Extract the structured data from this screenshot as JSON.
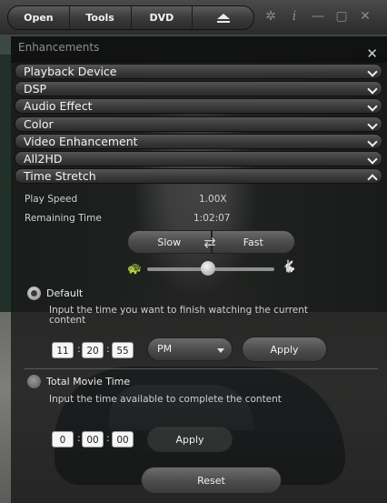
{
  "menu": {
    "open_label": "Open",
    "tools_label": "Tools",
    "dvd_label": "DVD"
  },
  "window_icons": [
    "settings-icon",
    "info-icon",
    "minimize-icon",
    "restore-icon",
    "close-icon"
  ],
  "panel": {
    "title": "Enhancements",
    "close_glyph": "✕",
    "sections": [
      {
        "label": "Playback Device",
        "expanded": false
      },
      {
        "label": "DSP",
        "expanded": false
      },
      {
        "label": "Audio Effect",
        "expanded": false
      },
      {
        "label": "Color",
        "expanded": false
      },
      {
        "label": "Video Enhancement",
        "expanded": false
      },
      {
        "label": "All2HD",
        "expanded": false
      },
      {
        "label": "Time Stretch",
        "expanded": true
      }
    ]
  },
  "time_stretch": {
    "play_speed_label": "Play Speed",
    "play_speed_value": "1.00X",
    "remaining_label": "Remaining Time",
    "remaining_value": "1:02:07",
    "slow_label": "Slow",
    "fast_label": "Fast",
    "speed_slider_level": 0.48,
    "default_option": {
      "label": "Default",
      "selected": true,
      "description": "Input the time you want to finish watching the current content",
      "hour": "11",
      "minute": "20",
      "second": "55",
      "ampm": "PM",
      "apply_label": "Apply"
    },
    "total_option": {
      "label": "Total Movie Time",
      "selected": false,
      "description": "Input the time available to complete the content",
      "hour": "0",
      "minute": "00",
      "second": "00",
      "apply_label": "Apply"
    },
    "reset_label": "Reset"
  }
}
